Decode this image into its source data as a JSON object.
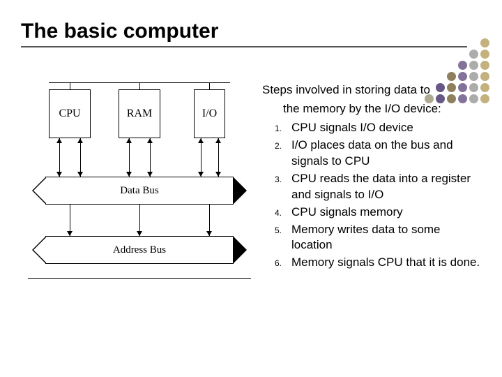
{
  "title": "The basic computer",
  "diagram": {
    "box_cpu": "CPU",
    "box_ram": "RAM",
    "box_io": "I/O",
    "bus_data": "Data Bus",
    "bus_addr": "Address Bus"
  },
  "text": {
    "intro_l1": "Steps involved in storing data to",
    "intro_l2": "the memory by the I/O device:",
    "steps": [
      {
        "n": "1.",
        "t": "CPU signals I/O device"
      },
      {
        "n": "2.",
        "t": "I/O places data on the bus and signals to CPU"
      },
      {
        "n": "3.",
        "t": "CPU reads the data into a register and signals to I/O"
      },
      {
        "n": "4.",
        "t": "CPU signals memory"
      },
      {
        "n": "5.",
        "t": "Memory writes data to some location"
      },
      {
        "n": "6.",
        "t": "Memory signals CPU that it is done."
      }
    ]
  },
  "dot_colors": [
    "#b8a566",
    "#9d9d9b",
    "#6d5a8a",
    "#7a6a42",
    "#4b3a6e",
    "#a09a7e"
  ]
}
